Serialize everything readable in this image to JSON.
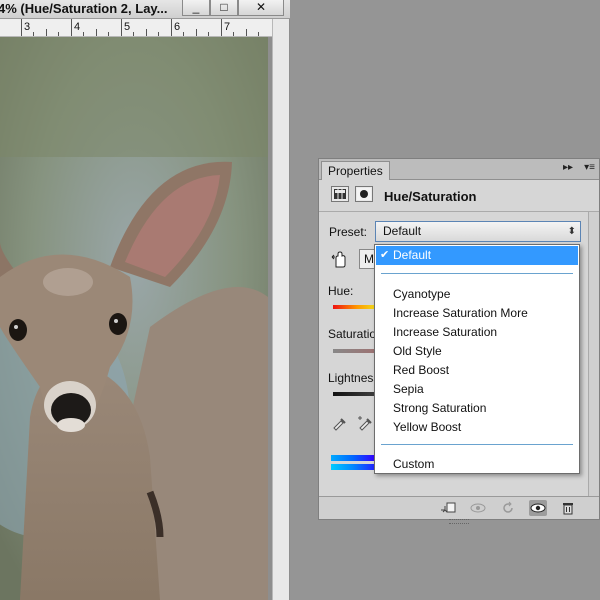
{
  "document_window": {
    "title": "4% (Hue/Saturation 2, Lay...",
    "minimize_label": "_",
    "restore_label": "□",
    "close_label": "✕",
    "ruler_numbers": [
      "3",
      "4",
      "5",
      "6",
      "7"
    ]
  },
  "properties_panel": {
    "tab_label": "Properties",
    "collapse_label": "▸▸",
    "menu_label": "▾≡",
    "title": "Hue/Saturation",
    "preset_label": "Preset:",
    "preset_value": "Default",
    "preset_arrow": "⬍",
    "targeted_adjust_icon": "hand-icon",
    "master_partial": "M",
    "hue_label": "Hue:",
    "saturation_label": "Saturation",
    "lightness_label": "Lightness",
    "colors": {
      "selected_bg": "#3399ff",
      "panel_bg": "#d6d6d6",
      "separator": "#6aa3cf"
    }
  },
  "preset_menu": {
    "check": "✔",
    "default_item": "Default",
    "items": [
      "Cyanotype",
      "Increase Saturation More",
      "Increase Saturation",
      "Old Style",
      "Red Boost",
      "Sepia",
      "Strong Saturation",
      "Yellow Boost"
    ],
    "custom_item": "Custom"
  }
}
